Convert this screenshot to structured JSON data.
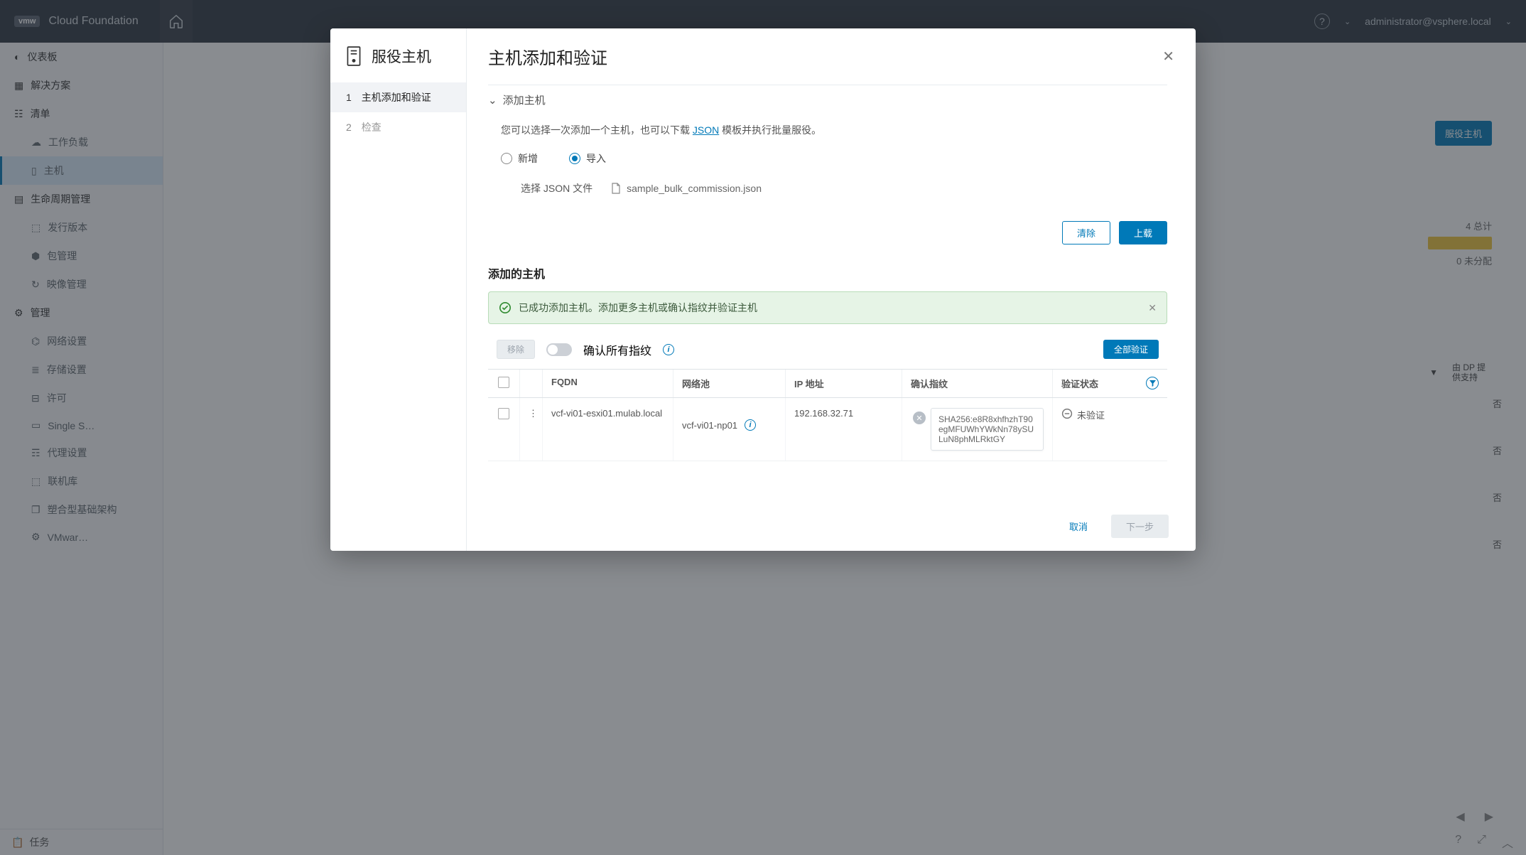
{
  "topbar": {
    "brand": "Cloud Foundation",
    "vmw": "vmw",
    "user": "administrator@vsphere.local"
  },
  "sidebar": {
    "dashboard": "仪表板",
    "solutions": "解决方案",
    "inventory": "清单",
    "workload": "工作负载",
    "hosts": "主机",
    "lifecycle": "生命周期管理",
    "release": "发行版本",
    "bundle": "包管理",
    "image": "映像管理",
    "admin": "管理",
    "network": "网络设置",
    "storage": "存储设置",
    "license": "许可",
    "single": "Single S…",
    "proxy": "代理设置",
    "depot": "联机库",
    "composable": "塑合型基础架构",
    "vmware": "VMwar…",
    "tasks": "任务"
  },
  "bg": {
    "commission_btn": "服役主机",
    "total": "4 总计",
    "unassigned": "0 未分配",
    "dp_header": "由 DP 提供支持",
    "no": "否"
  },
  "dialog": {
    "left_title": "服役主机",
    "step1": "主机添加和验证",
    "step2": "检查",
    "title": "主机添加和验证",
    "section_add": "添加主机",
    "desc_prefix": "您可以选择一次添加一个主机，也可以下载 ",
    "desc_link": "JSON",
    "desc_suffix": " 模板并执行批量服役。",
    "radio_new": "新增",
    "radio_import": "导入",
    "choose_file": "选择 JSON 文件",
    "file_name": "sample_bulk_commission.json",
    "clear_btn": "清除",
    "upload_btn": "上载",
    "added_hosts_title": "添加的主机",
    "success_msg": "已成功添加主机。添加更多主机或确认指纹并验证主机",
    "remove_btn": "移除",
    "confirm_all_fp": "确认所有指纹",
    "validate_all": "全部验证",
    "col_fqdn": "FQDN",
    "col_pool": "网络池",
    "col_ip": "IP 地址",
    "col_fp": "确认指纹",
    "col_status": "验证状态",
    "row_fqdn": "vcf-vi01-esxi01.mulab.local",
    "row_pool": "vcf-vi01-np01",
    "row_ip": "192.168.32.71",
    "row_fp": "SHA256:e8R8xhfhzhT90egMFUWhYWkNn78ySULuN8phMLRktGY",
    "row_status": "未验证",
    "cancel": "取消",
    "next": "下一步"
  }
}
